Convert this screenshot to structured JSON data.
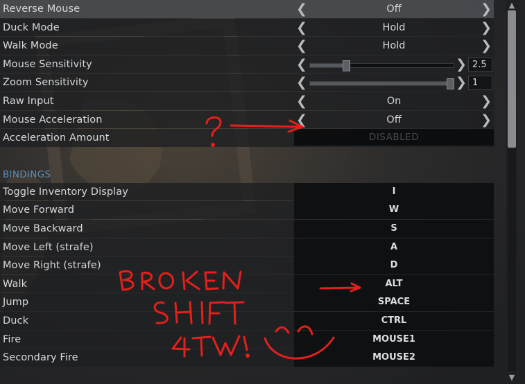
{
  "settings": [
    {
      "label": "Reverse Mouse",
      "value": "Off"
    },
    {
      "label": "Duck Mode",
      "value": "Hold"
    },
    {
      "label": "Walk Mode",
      "value": "Hold"
    },
    {
      "label": "Mouse Sensitivity",
      "value": "2.5",
      "slider_fraction": 0.24
    },
    {
      "label": "Zoom Sensitivity",
      "value": "1",
      "slider_fraction": 1.0
    },
    {
      "label": "Raw Input",
      "value": "On"
    },
    {
      "label": "Mouse Acceleration",
      "value": "Off"
    },
    {
      "label": "Acceleration Amount",
      "value": "DISABLED"
    }
  ],
  "bindings_title": "BINDINGS",
  "bindings": [
    {
      "label": "Toggle Inventory Display",
      "key": "I"
    },
    {
      "label": "Move Forward",
      "key": "W"
    },
    {
      "label": "Move Backward",
      "key": "S"
    },
    {
      "label": "Move Left (strafe)",
      "key": "A"
    },
    {
      "label": "Move Right (strafe)",
      "key": "D"
    },
    {
      "label": "Walk",
      "key": "ALT"
    },
    {
      "label": "Jump",
      "key": "SPACE"
    },
    {
      "label": "Duck",
      "key": "CTRL"
    },
    {
      "label": "Fire",
      "key": "MOUSE1"
    },
    {
      "label": "Secondary Fire",
      "key": "MOUSE2"
    }
  ],
  "annotations": {
    "question": "?",
    "line1": "BROKEN",
    "line2": "SHIFT",
    "line3": "4TW!",
    "color": "#e3201b"
  },
  "icons": {
    "left_arrow": "chevron-left-icon",
    "right_arrow": "chevron-right-icon"
  },
  "colors": {
    "section_title": "#5d8fb4",
    "highlight_row": "#4a4c50"
  }
}
